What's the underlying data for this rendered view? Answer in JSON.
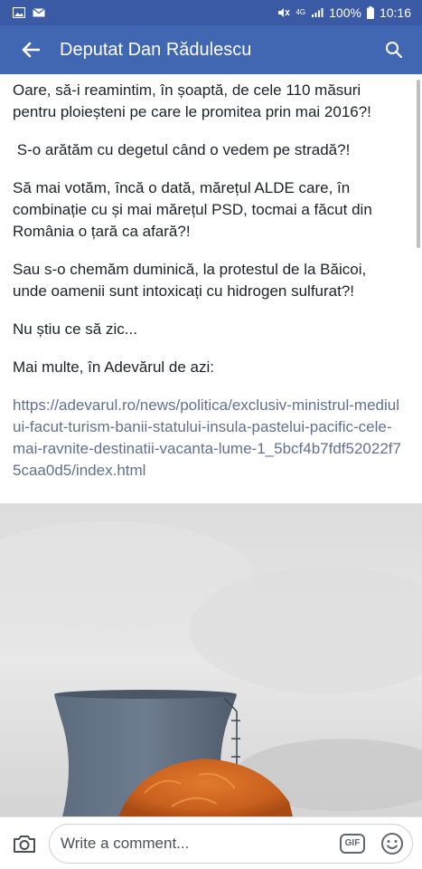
{
  "status_bar": {
    "network": "4G",
    "battery": "100%",
    "time": "10:16",
    "icons": [
      "image-notification-icon",
      "mail-notification-icon",
      "mute-icon",
      "signal-icon",
      "battery-icon"
    ]
  },
  "app_bar": {
    "title": "Deputat Dan Rădulescu",
    "icons": [
      "back-arrow-icon",
      "search-icon"
    ]
  },
  "post": {
    "paragraphs": [
      "Oare, să-i reamintim, în șoaptă, de cele 110 măsuri pentru ploieșteni pe care le promitea prin mai 2016?!",
      " S-o arătăm cu degetul când o vedem pe stradă?!",
      "Să mai votăm, încă o dată, mărețul ALDE care, în combinație cu și mai mărețul PSD, tocmai a făcut din România o țară ca afară?!",
      "Sau s-o chemăm duminică, la protestul de la Băicoi, unde oamenii sunt intoxicați cu hidrogen sulfurat?!",
      "Nu știu ce să zic...",
      "Mai multe, în Adevărul de azi:"
    ],
    "link": "https://adevarul.ro/news/politica/exclusiv-ministrul-mediului-facut-turism-banii-statului-insula-pastelui-pacific-cele-mai-ravnite-destinatii-vacanta-lume-1_5bcf4b7fdf52022f75caa0d5/index.html",
    "image": "cooling-tower-photo"
  },
  "comment_bar": {
    "placeholder": "Write a comment...",
    "gif_label": "GIF",
    "icons": [
      "camera-icon",
      "gif-icon",
      "emoji-icon"
    ]
  },
  "colors": {
    "status_bar": "#3b5aa6",
    "app_bar": "#4267b2",
    "text": "#1d2129",
    "link": "#62718f"
  }
}
